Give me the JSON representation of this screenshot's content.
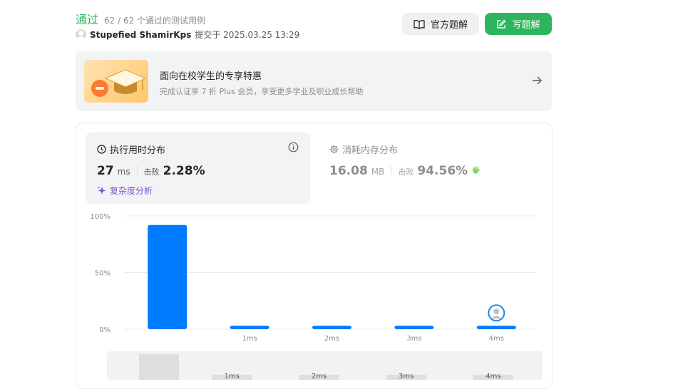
{
  "header": {
    "status": "通过",
    "cases": "62 / 62 个通过的测试用例",
    "username": "Stupefied ShamirKps",
    "submitted": "提交于 2025.03.25 13:29",
    "official_solution_label": "官方题解",
    "write_solution_label": "写题解"
  },
  "promo": {
    "title": "面向在校学生的专享特惠",
    "subtitle": "完成认证享 7 折 Plus 会员，享受更多学业及职业成长帮助"
  },
  "runtime": {
    "label": "执行用时分布",
    "value": "27",
    "unit": "ms",
    "beat_label": "击败",
    "beat_value": "2.28%",
    "complexity_label": "复杂度分析"
  },
  "memory": {
    "label": "消耗内存分布",
    "value": "16.08",
    "unit": "MB",
    "beat_label": "击败",
    "beat_value": "94.56%"
  },
  "colors": {
    "accent_green": "#2db55d",
    "bar_blue": "#007aff",
    "complexity_purple": "#7c4dd6"
  },
  "chart_data": {
    "type": "bar",
    "categories": [
      "",
      "1ms",
      "2ms",
      "3ms",
      "4ms"
    ],
    "values": [
      92,
      3,
      3,
      3,
      3
    ],
    "y_ticks": [
      "0%",
      "50%",
      "100%"
    ],
    "ylim": [
      0,
      100
    ],
    "grid": true,
    "user_marker_category": "4ms",
    "overview_labels": [
      "1ms",
      "2ms",
      "3ms",
      "4ms"
    ]
  }
}
